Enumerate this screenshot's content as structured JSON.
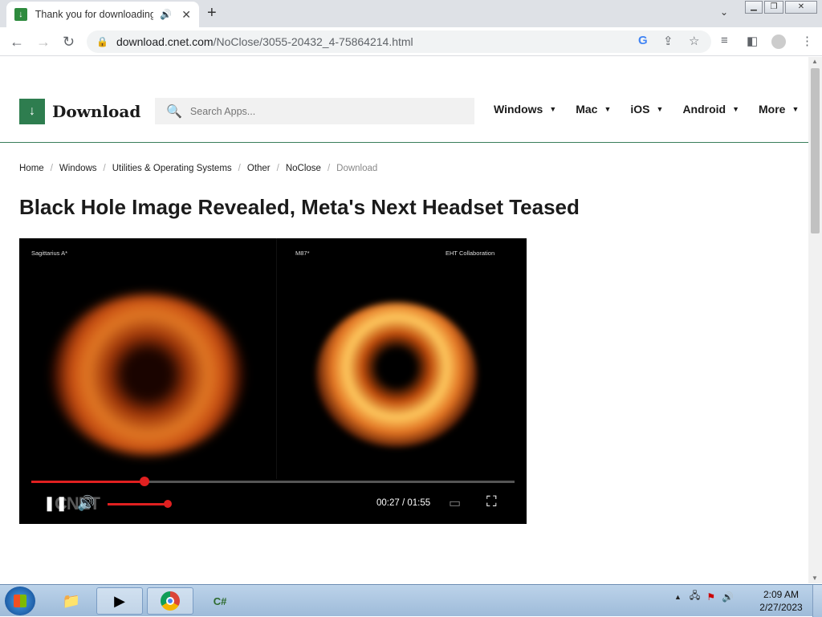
{
  "browser": {
    "tab_title": "Thank you for downloading",
    "url_host": "download.cnet.com",
    "url_path": "/NoClose/3055-20432_4-75864214.html"
  },
  "site": {
    "logo_text": "Download",
    "search_placeholder": "Search Apps...",
    "nav": [
      "Windows",
      "Mac",
      "iOS",
      "Android",
      "More"
    ]
  },
  "breadcrumb": [
    "Home",
    "Windows",
    "Utilities & Operating Systems",
    "Other",
    "NoClose",
    "Download"
  ],
  "headline": "Black Hole Image Revealed, Meta's Next Headset Teased",
  "video": {
    "caption_left": "Sagittarius A*",
    "caption_mid": "M87*",
    "caption_right": "EHT Collaboration",
    "watermark": "CNET",
    "current_time": "00:27",
    "duration": "01:55",
    "progress_fraction": 0.235,
    "volume_fraction": 1.0
  },
  "taskbar": {
    "time": "2:09 AM",
    "date": "2/27/2023"
  }
}
